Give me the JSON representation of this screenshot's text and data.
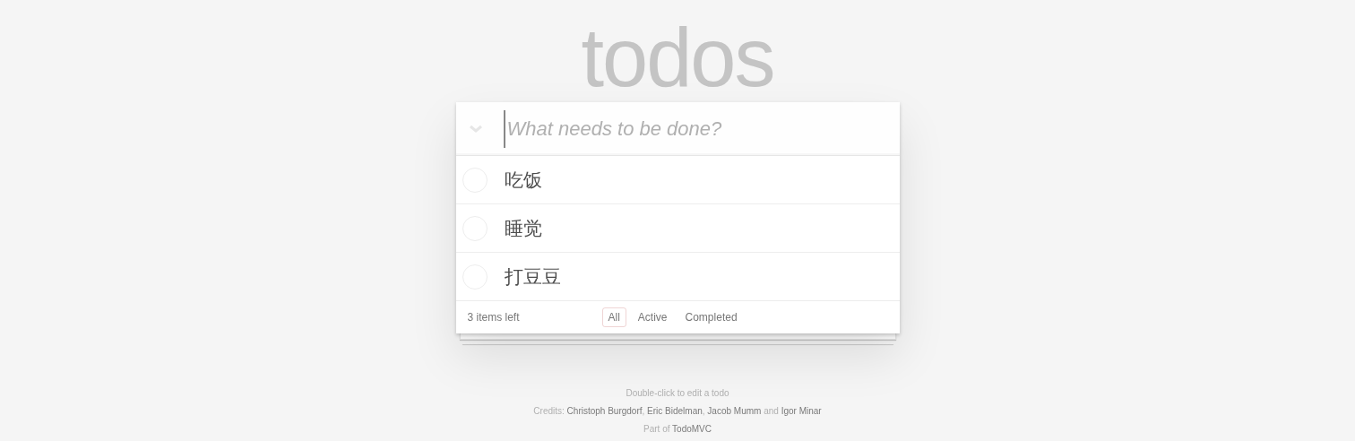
{
  "title": "todos",
  "new_todo": {
    "placeholder": "What needs to be done?"
  },
  "todos": [
    {
      "title": "吃饭",
      "completed": false
    },
    {
      "title": "睡觉",
      "completed": false
    },
    {
      "title": "打豆豆",
      "completed": false
    }
  ],
  "footer": {
    "count": "3 items left",
    "filters": [
      {
        "label": "All",
        "selected": true
      },
      {
        "label": "Active",
        "selected": false
      },
      {
        "label": "Completed",
        "selected": false
      }
    ]
  },
  "info": {
    "hint": "Double-click to edit a todo",
    "credits": [
      {
        "text": "Credits: ",
        "link": false
      },
      {
        "text": "Christoph Burgdorf",
        "link": true
      },
      {
        "text": ", ",
        "link": false
      },
      {
        "text": "Eric Bidelman",
        "link": true
      },
      {
        "text": ", ",
        "link": false
      },
      {
        "text": "Jacob Mumm",
        "link": true
      },
      {
        "text": " and ",
        "link": false
      },
      {
        "text": "Igor Minar",
        "link": true
      }
    ],
    "part_of": [
      {
        "text": "Part of ",
        "link": false
      },
      {
        "text": "TodoMVC",
        "link": true
      }
    ]
  }
}
